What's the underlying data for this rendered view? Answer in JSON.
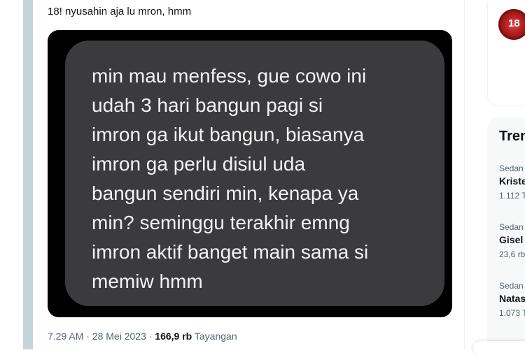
{
  "tweet": {
    "text": "18! nyusahin aja lu mron, hmm",
    "image_text": "min mau menfess, gue cowo ini\nudah 3 hari bangun pagi si\nimron ga ikut bangun, biasanya\nimron ga perlu disiul uda\nbangun sendiri min, kenapa ya\nmin? seminggu terakhir emng\nimron aktif banget main sama si\nmemiw hmm",
    "time": "7.29 AM · 28 Mei 2023 · ",
    "views": "166,9 rb",
    "views_label": " Tayangan"
  },
  "sidebar": {
    "avatar_text": "18",
    "trends_title": "Tren",
    "trends": [
      {
        "category": "Sedan",
        "name": "Kriste",
        "count": "1.112 T"
      },
      {
        "category": "Sedan",
        "name": "Gisel",
        "count": "23,6 rb"
      },
      {
        "category": "Sedan",
        "name": "Natas",
        "count": "1.073 T"
      }
    ]
  },
  "colors": {
    "bubble": "#3b3b3d",
    "media_bg": "#000000",
    "rail": "#c5d3db",
    "muted": "#536471"
  }
}
